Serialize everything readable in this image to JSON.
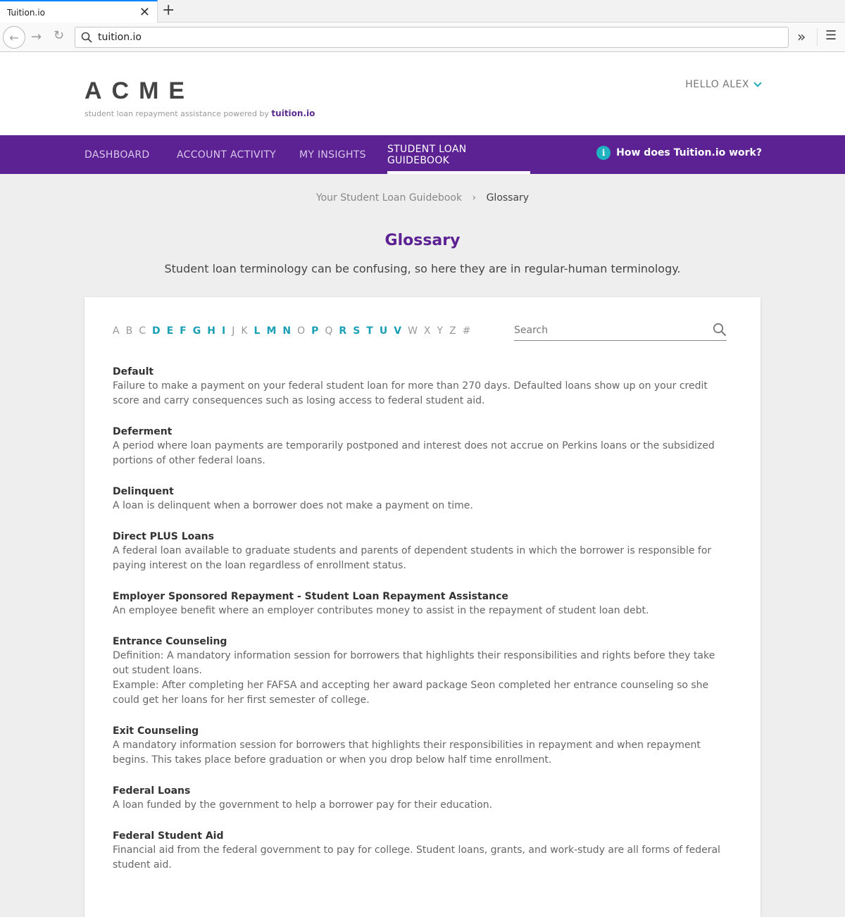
{
  "browser": {
    "tab_title": "Tuition.io",
    "url": "tuition.io"
  },
  "header": {
    "logo": "ACME",
    "tagline": "student loan repayment assistance powered by",
    "tagline_brand": "tuition.io",
    "greeting": "HELLO ALEX"
  },
  "nav": {
    "items": [
      {
        "label": "DASHBOARD"
      },
      {
        "label": "ACCOUNT ACTIVITY"
      },
      {
        "label": "MY INSIGHTS"
      },
      {
        "label": "STUDENT LOAN GUIDEBOOK"
      }
    ],
    "help_label": "How does Tuition.io work?",
    "accent": "#5c2192"
  },
  "breadcrumb": {
    "parent": "Your Student Loan Guidebook",
    "separator": "›",
    "current": "Glossary"
  },
  "page": {
    "title": "Glossary",
    "subtitle": "Student loan terminology can be confusing, so here they are in regular-human terminology."
  },
  "alphabet": {
    "letters": [
      "A",
      "B",
      "C",
      "D",
      "E",
      "F",
      "G",
      "H",
      "I",
      "J",
      "K",
      "L",
      "M",
      "N",
      "O",
      "P",
      "Q",
      "R",
      "S",
      "T",
      "U",
      "V",
      "W",
      "X",
      "Y",
      "Z",
      "#"
    ],
    "active": [
      "D",
      "E",
      "F",
      "G",
      "H",
      "I",
      "L",
      "M",
      "N",
      "P",
      "R",
      "S",
      "T",
      "U",
      "V"
    ]
  },
  "search": {
    "placeholder": "Search"
  },
  "glossary": [
    {
      "term": "Default",
      "definition": [
        "Failure to make a payment on your federal student loan for more than 270 days. Defaulted loans show up on your credit score and carry consequences such as losing access to federal student aid."
      ]
    },
    {
      "term": "Deferment",
      "definition": [
        "A period where loan payments are temporarily postponed and interest does not accrue on Perkins loans or the subsidized portions of other federal loans."
      ]
    },
    {
      "term": "Delinquent",
      "definition": [
        "A loan is delinquent when a borrower does not make a payment on time."
      ]
    },
    {
      "term": "Direct PLUS Loans",
      "definition": [
        "A federal loan available to graduate students and parents of dependent students in which the borrower is responsible for paying interest on the loan regardless of enrollment status."
      ]
    },
    {
      "term": "Employer Sponsored Repayment - Student Loan Repayment Assistance",
      "definition": [
        "An employee benefit where an employer contributes money to assist in the repayment of student loan debt."
      ]
    },
    {
      "term": "Entrance Counseling",
      "definition": [
        "Definition: A mandatory information session for borrowers that highlights their responsibilities and rights before they take out student loans.",
        "Example: After completing her FAFSA and accepting her award package Seon completed her entrance counseling so she could get her loans for her first semester of college."
      ]
    },
    {
      "term": "Exit Counseling",
      "definition": [
        "A mandatory information session for borrowers that highlights their responsibilities in repayment and when repayment begins. This takes place before graduation or when you drop below half time enrollment."
      ]
    },
    {
      "term": "Federal Loans",
      "definition": [
        "A loan funded by the government to help a borrower pay for their education."
      ]
    },
    {
      "term": "Federal Student Aid",
      "definition": [
        "Financial aid from the federal government to pay for college. Student loans, grants, and work-study are all forms of federal student aid."
      ]
    }
  ]
}
